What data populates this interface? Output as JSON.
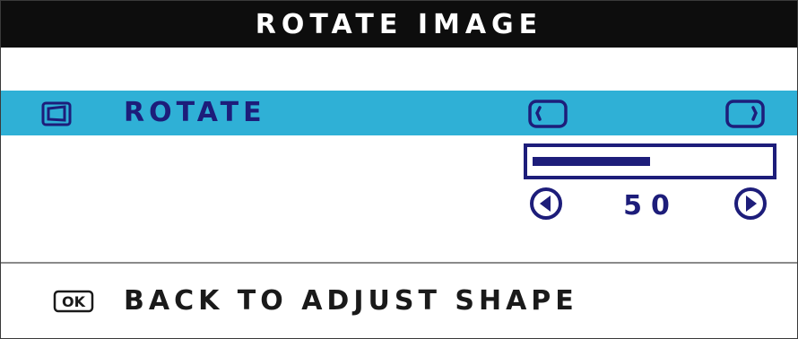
{
  "title": "ROTATE IMAGE",
  "rotate_row": {
    "label": "ROTATE",
    "icon": "rotate-icon",
    "left_icon": "rotate-ccw-icon",
    "right_icon": "rotate-cw-icon",
    "highlight_color": "#2fb0d6"
  },
  "slider": {
    "value": "50",
    "fill_fraction": 0.5,
    "decrease_icon": "arrow-left-circle-icon",
    "increase_icon": "arrow-right-circle-icon",
    "color": "#1d1d7a"
  },
  "footer": {
    "ok_key": "OK",
    "back_label": "BACK TO ADJUST SHAPE"
  }
}
